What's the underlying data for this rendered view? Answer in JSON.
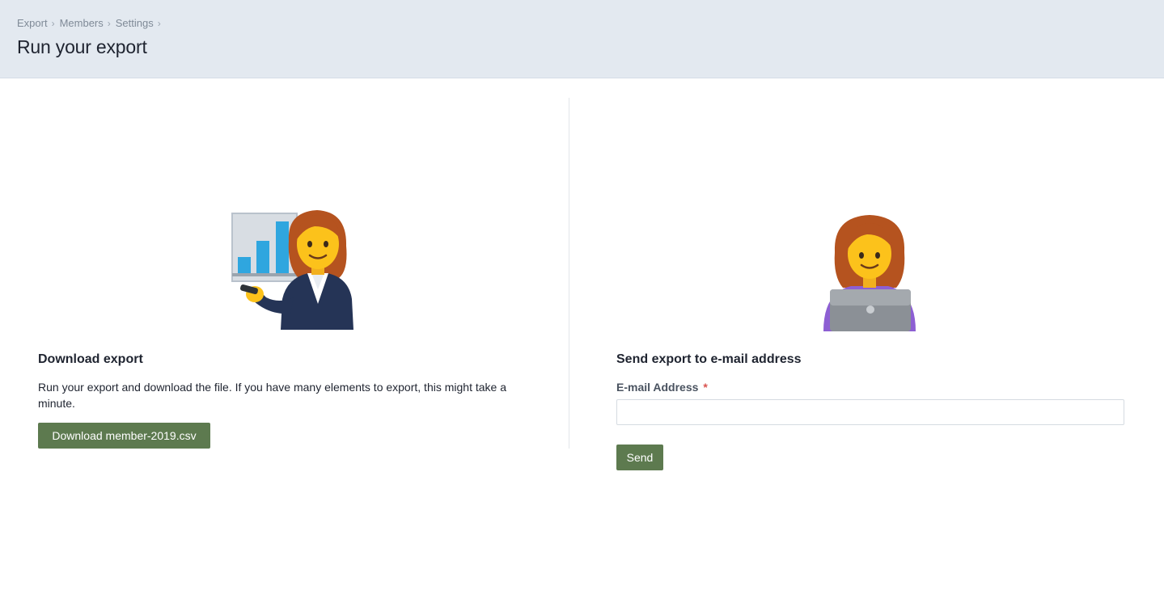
{
  "header": {
    "breadcrumb": [
      "Export",
      "Members",
      "Settings"
    ],
    "breadcrumb_separator": "›",
    "title": "Run your export"
  },
  "download": {
    "title": "Download export",
    "description": "Run your export and download the file. If you have many elements to export, this might take a minute.",
    "button_label": "Download member-2019.csv",
    "illustration": "woman-presenting-chart-icon"
  },
  "email": {
    "title": "Send export to e-mail address",
    "field_label": "E-mail Address",
    "required_mark": "*",
    "input_value": "",
    "input_placeholder": "",
    "button_label": "Send",
    "illustration": "woman-at-laptop-icon"
  },
  "colors": {
    "header_bg": "#e3e9f0",
    "button_bg": "#5d7a4f",
    "required": "#d9534f"
  }
}
